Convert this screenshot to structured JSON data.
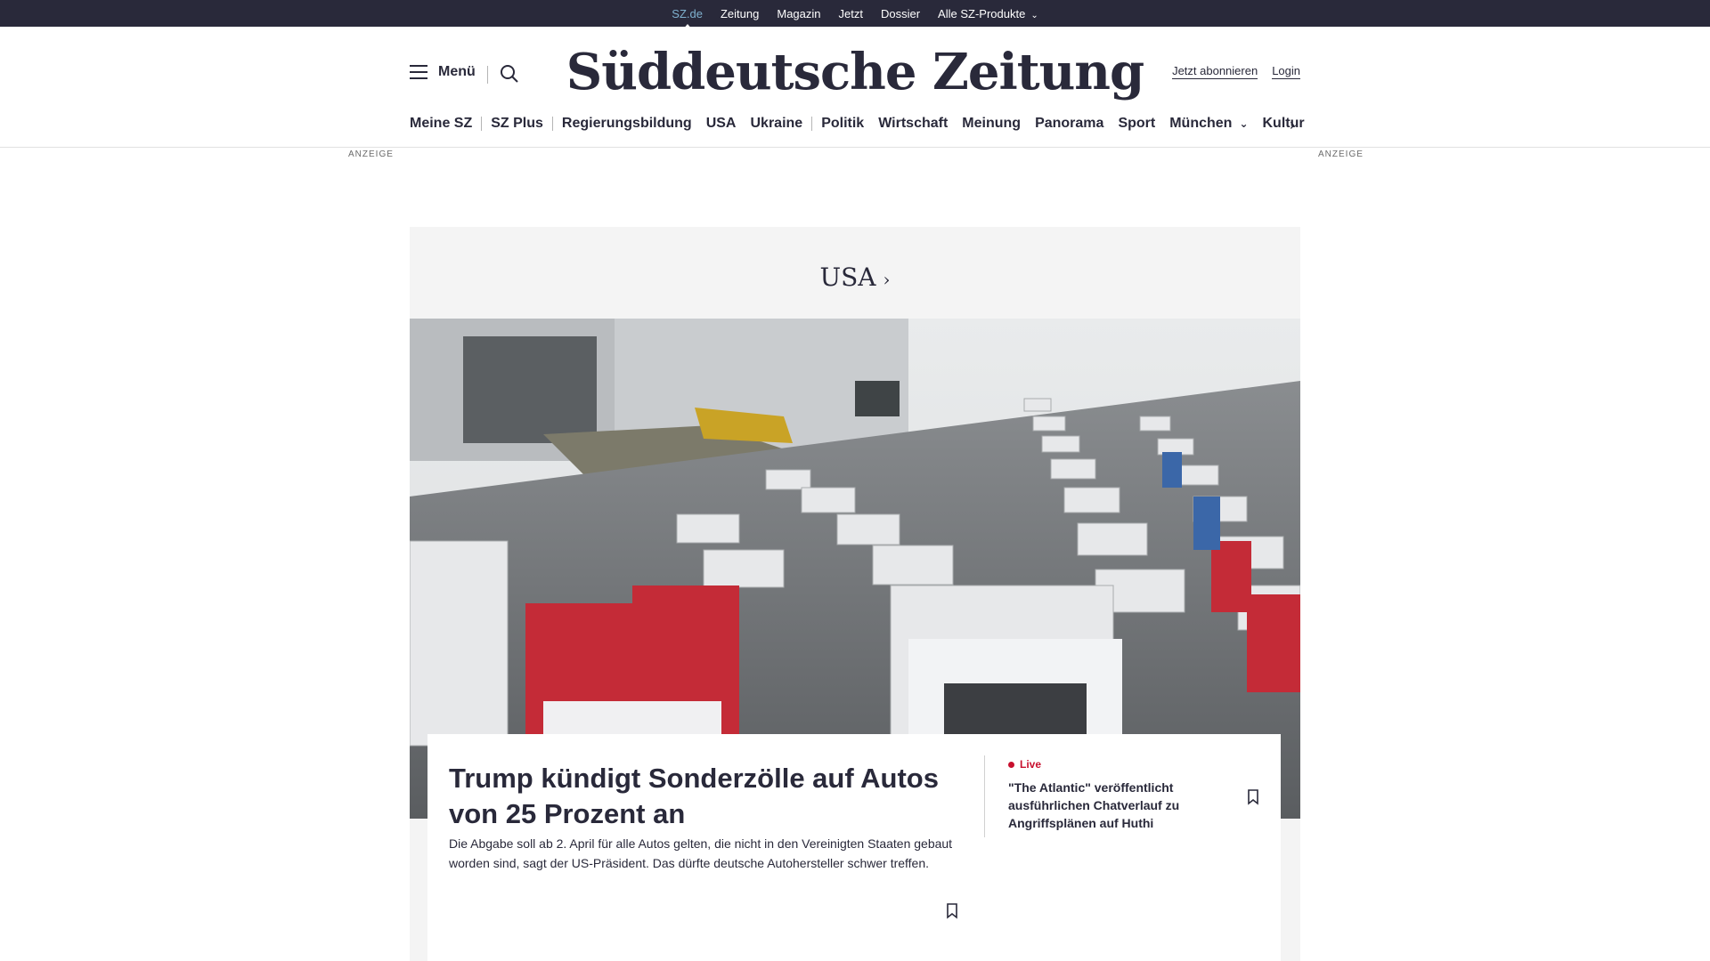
{
  "topbar": {
    "items": [
      "SZ.de",
      "Zeitung",
      "Magazin",
      "Jetzt",
      "Dossier",
      "Alle SZ-Produkte"
    ]
  },
  "header": {
    "menu_label": "Menü",
    "logo_text": "Süddeutsche Zeitung",
    "subscribe_label": "Jetzt abonnieren",
    "login_label": "Login"
  },
  "nav": {
    "items": [
      "Meine SZ",
      "SZ Plus",
      "Regierungsbildung",
      "USA",
      "Ukraine",
      "Politik",
      "Wirtschaft",
      "Meinung",
      "Panorama",
      "Sport",
      "München",
      "Kultur"
    ]
  },
  "ads": {
    "left": "ANZEIGE",
    "right": "ANZEIGE"
  },
  "section": {
    "title": "USA"
  },
  "main_article": {
    "headline": "Trump kündigt Sonderzölle auf Autos von 25 Prozent an",
    "teaser": "Die Abgabe soll ab 2. April für alle Autos gelten, die nicht in den Vereinigten Staaten gebaut worden sind, sagt der US-Präsident. Das dürfte deutsche Autohersteller schwer treffen."
  },
  "side_article": {
    "badge": "Live",
    "headline": "\"The Atlantic\" veröffentlicht ausführlichen Chatverlauf zu Angriffsplänen auf Huthi"
  },
  "colors": {
    "topbar_bg": "#29293a",
    "active_link": "#7fb1cf",
    "live_red": "#c8102e",
    "section_bg": "#f4f4f4"
  }
}
